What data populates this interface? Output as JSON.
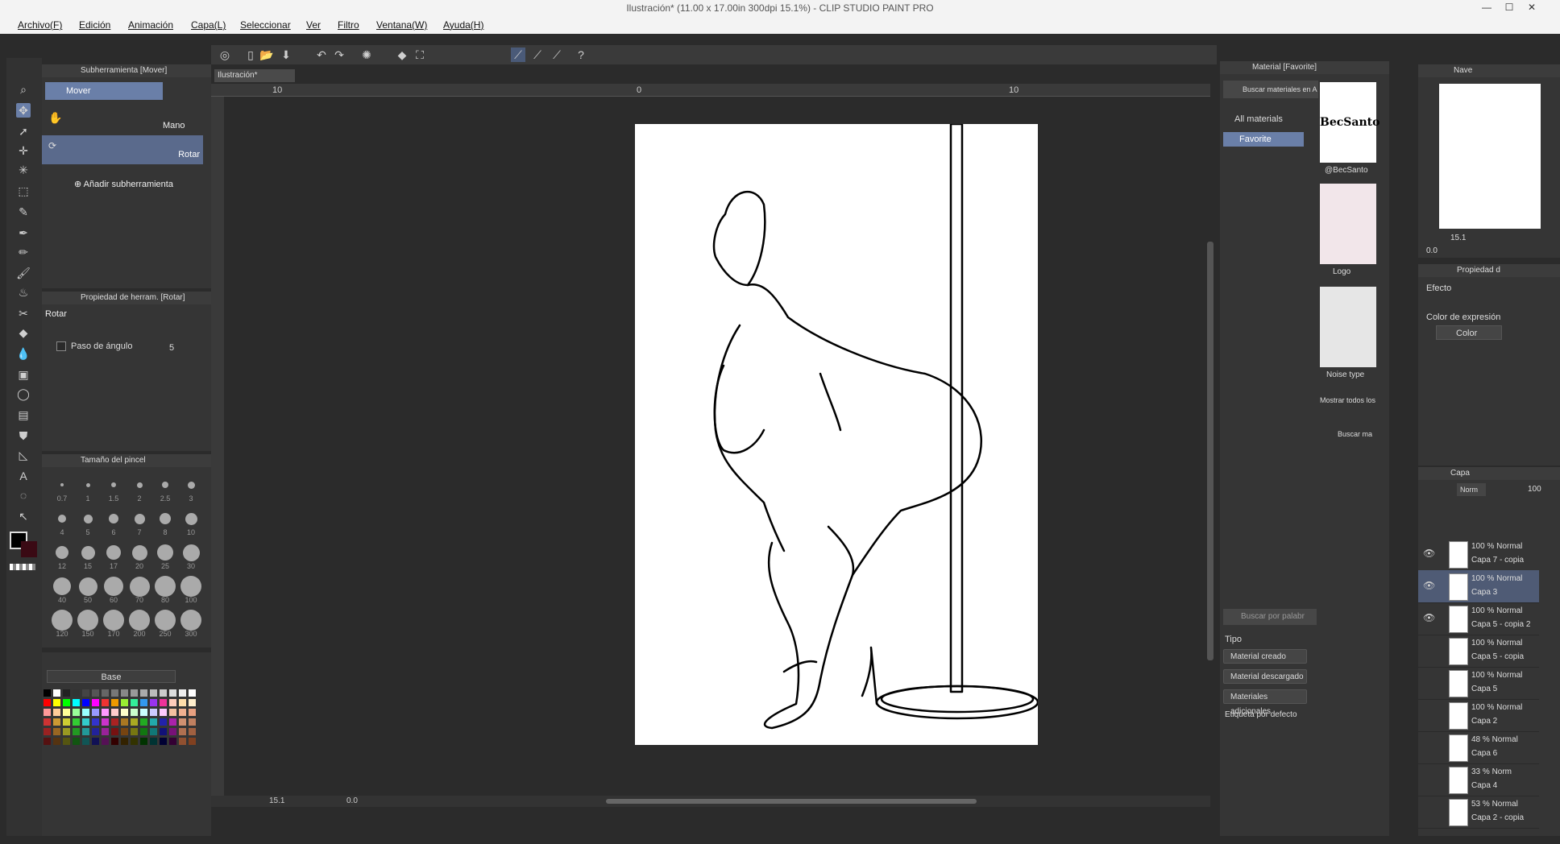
{
  "window": {
    "title": "Ilustración* (11.00 x 17.00in 300dpi 15.1%) - CLIP STUDIO PAINT PRO"
  },
  "menu": [
    "Archivo(F)",
    "Edición",
    "Animación",
    "Capa(L)",
    "Seleccionar",
    "Ver",
    "Filtro",
    "Ventana(W)",
    "Ayuda(H)"
  ],
  "subtool": {
    "header": "Subherramienta [Mover]",
    "group": "Mover",
    "items": [
      "Mano",
      "Rotar"
    ],
    "add": "Añadir subherramienta"
  },
  "toolprop": {
    "header": "Propiedad de herram. [Rotar]",
    "name": "Rotar",
    "angle_label": "Paso de ángulo",
    "angle_value": "5"
  },
  "brushsize": {
    "header": "Tamaño del pincel",
    "sizes": [
      "0.7",
      "1",
      "1.5",
      "2",
      "2.5",
      "3",
      "4",
      "5",
      "6",
      "7",
      "8",
      "10",
      "12",
      "15",
      "17",
      "20",
      "25",
      "30",
      "40",
      "50",
      "60",
      "70",
      "80",
      "100",
      "120",
      "150",
      "170",
      "200",
      "250",
      "300"
    ]
  },
  "palette": {
    "set": "Base"
  },
  "canvas": {
    "tab": "Ilustración*",
    "ruler": [
      "10",
      "0",
      "10"
    ],
    "zoom": "15.1",
    "angle": "0.0"
  },
  "material": {
    "header": "Material [Favorite]",
    "search_placeholder": "Buscar materiales en A",
    "tree": [
      "All materials",
      "Favorite"
    ],
    "items": [
      "@BecSanto",
      "Logo",
      "Noise type"
    ],
    "show_all": "Mostrar todos los",
    "search_btn": "Buscar ma",
    "keyword_placeholder": "Buscar por palabr",
    "type_label": "Tipo",
    "type_buttons": [
      "Material creado",
      "Material descargado",
      "Materiales adicionales",
      "Etiqueta por defecto"
    ],
    "logo_text": "BecSanto"
  },
  "navigator": {
    "header": "Nave",
    "zoom": "15.1",
    "angle": "0.0"
  },
  "layerprop": {
    "header": "Propiedad d",
    "effect": "Efecto",
    "expr_label": "Color de expresión",
    "expr_value": "Color"
  },
  "layers": {
    "header": "Capa",
    "blend": "Norm",
    "opacity": "100",
    "rows": [
      {
        "mode": "100 % Normal",
        "name": "Capa 7 - copia"
      },
      {
        "mode": "100 % Normal",
        "name": "Capa 3"
      },
      {
        "mode": "100 % Normal",
        "name": "Capa 5 - copia 2"
      },
      {
        "mode": "100 % Normal",
        "name": "Capa 5 - copia"
      },
      {
        "mode": "100 % Normal",
        "name": "Capa 5"
      },
      {
        "mode": "100 % Normal",
        "name": "Capa 2"
      },
      {
        "mode": "48 % Normal",
        "name": "Capa 6"
      },
      {
        "mode": "33 % Norm",
        "name": "Capa 4"
      },
      {
        "mode": "53 % Normal",
        "name": "Capa 2 - copia"
      }
    ]
  },
  "colors": {
    "accent": "#6a7fa8",
    "panel": "#353535",
    "canvas_bg": "#2b2b2b"
  }
}
